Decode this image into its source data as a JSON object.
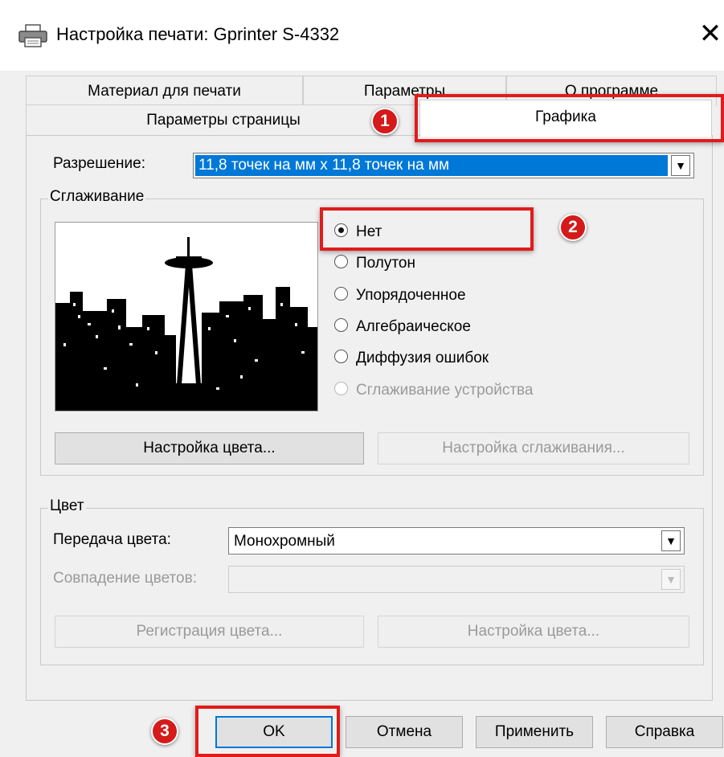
{
  "window": {
    "title": "Настройка печати: Gprinter S-4332",
    "icon": "printer-icon",
    "close_glyph": "✕"
  },
  "tabs": {
    "row_back": [
      "Материал для печати",
      "Параметры",
      "О программе"
    ],
    "row_front": [
      "Параметры страницы",
      "Графика"
    ],
    "active": "Графика"
  },
  "resolution": {
    "label": "Разрешение:",
    "value": "11,8 точек на мм x 11,8 точек на мм"
  },
  "dithering": {
    "legend": "Сглаживание",
    "options": [
      {
        "label": "Нет",
        "checked": true,
        "enabled": true
      },
      {
        "label": "Полутон",
        "checked": false,
        "enabled": true
      },
      {
        "label": "Упорядоченное",
        "checked": false,
        "enabled": true
      },
      {
        "label": "Алгебраическое",
        "checked": false,
        "enabled": true
      },
      {
        "label": "Диффузия ошибок",
        "checked": false,
        "enabled": true
      },
      {
        "label": "Сглаживание устройства",
        "checked": false,
        "enabled": false
      }
    ],
    "color_settings_button": "Настройка цвета...",
    "dither_settings_button": "Настройка сглаживания..."
  },
  "color": {
    "legend": "Цвет",
    "transfer_label": "Передача цвета:",
    "transfer_value": "Монохромный",
    "matching_label": "Совпадение цветов:",
    "matching_value": "",
    "register_button": "Регистрация цвета...",
    "settings_button": "Настройка цвета..."
  },
  "buttons": {
    "ok": "OK",
    "cancel": "Отмена",
    "apply": "Применить",
    "help": "Справка"
  },
  "annotations": {
    "badge_1": "1",
    "badge_2": "2",
    "badge_3": "3",
    "color": "#e21b1b"
  },
  "colors": {
    "selection": "#0078d7",
    "ok_border": "#0078d7"
  }
}
